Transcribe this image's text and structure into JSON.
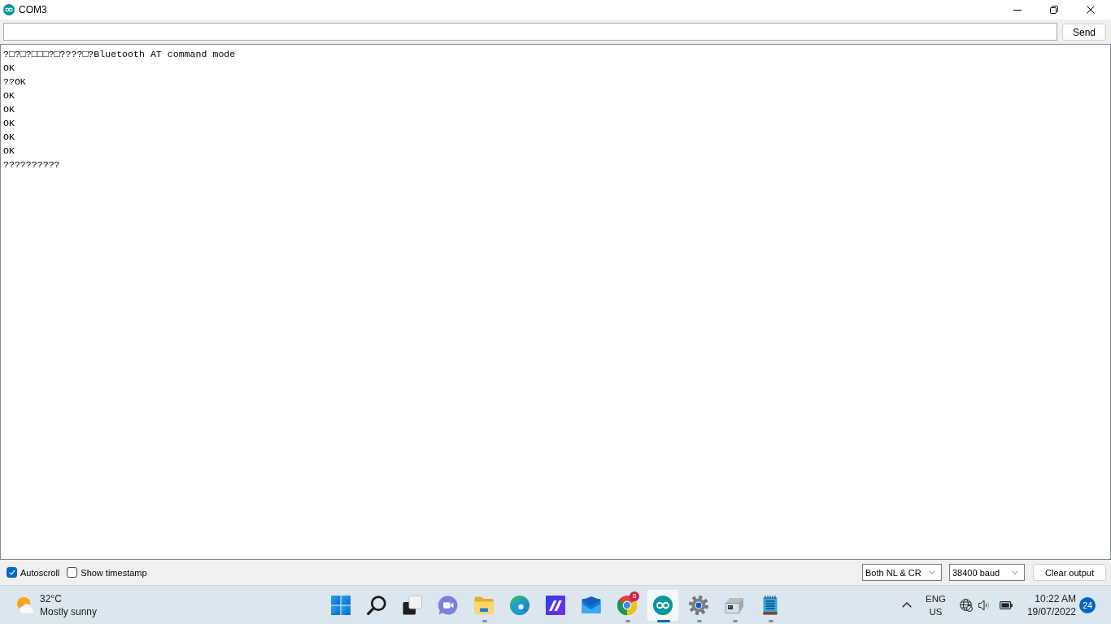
{
  "window": {
    "title": "COM3"
  },
  "input_bar": {
    "send_button": "Send"
  },
  "serial_output": {
    "lines": [
      "?□?□?□□□?□????□?Bluetooth AT command mode",
      "OK",
      "??OK",
      "OK",
      "OK",
      "OK",
      "OK",
      "OK",
      "??????????"
    ]
  },
  "footer": {
    "options": [
      {
        "label": "Autoscroll",
        "checked": true
      },
      {
        "label": "Show timestamp",
        "checked": false
      }
    ],
    "line_ending": "Both NL & CR",
    "baud_rate": "38400 baud",
    "clear_button": "Clear output"
  },
  "taskbar": {
    "weather": {
      "temperature": "32°C",
      "condition": "Mostly sunny"
    },
    "apps": [
      {
        "kind": "start",
        "running": false,
        "selected": false
      },
      {
        "kind": "search",
        "running": false,
        "selected": false
      },
      {
        "kind": "taskview",
        "running": false,
        "selected": false
      },
      {
        "kind": "chat",
        "running": false,
        "selected": false
      },
      {
        "kind": "explorer",
        "running": true,
        "selected": false
      },
      {
        "kind": "edge",
        "running": false,
        "selected": false
      },
      {
        "kind": "stripes",
        "running": false,
        "selected": false
      },
      {
        "kind": "mail",
        "running": false,
        "selected": false
      },
      {
        "kind": "chrome",
        "running": true,
        "selected": false,
        "badge": "S"
      },
      {
        "kind": "arduino",
        "running": true,
        "selected": true
      },
      {
        "kind": "settings",
        "running": true,
        "selected": false
      },
      {
        "kind": "device",
        "running": true,
        "selected": false
      },
      {
        "kind": "notepad",
        "running": true,
        "selected": false
      }
    ],
    "tray": {
      "language": "ENG",
      "region": "US",
      "time": "10:22 AM",
      "date": "19/07/2022",
      "notifications": "24"
    }
  }
}
